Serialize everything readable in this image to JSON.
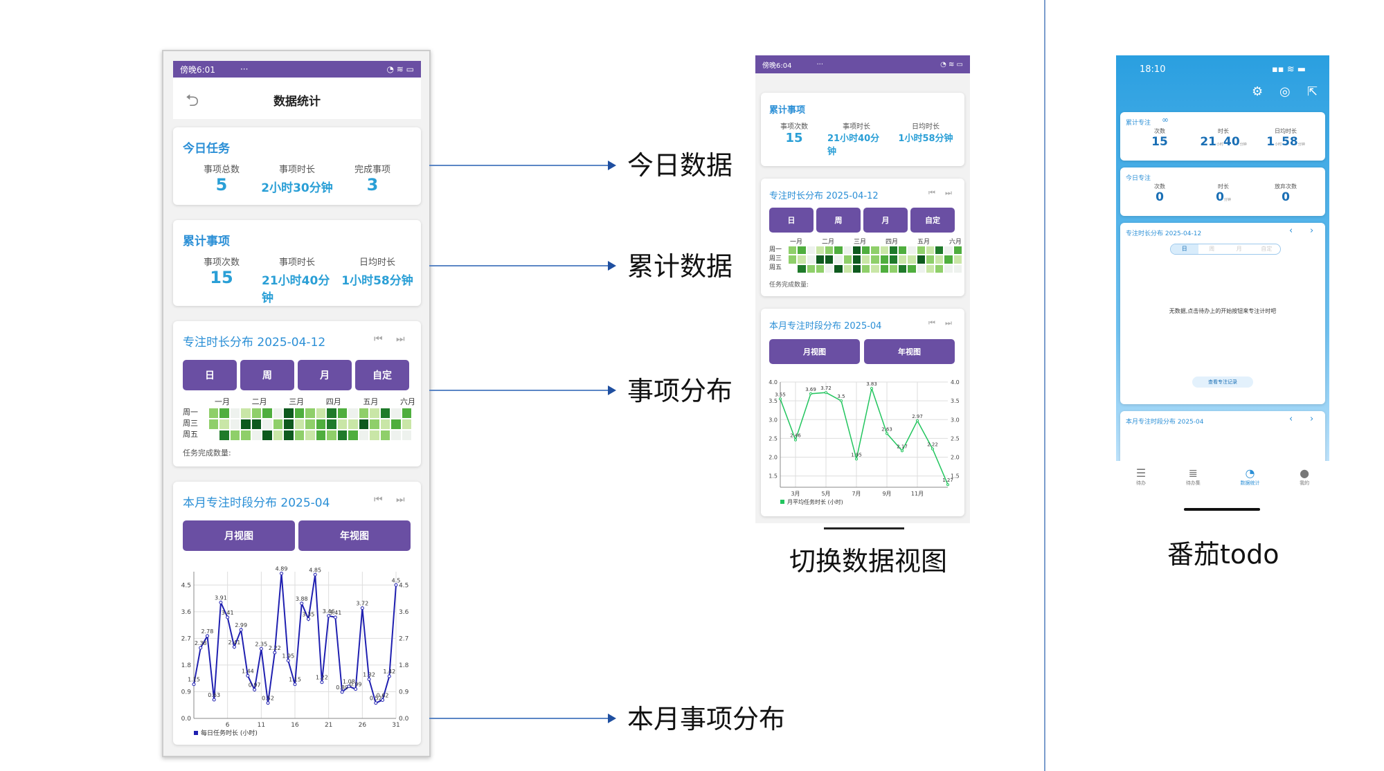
{
  "colors": {
    "purple": "#6a4fa3",
    "blue": "#2b8fd6",
    "green": "#22c55e",
    "navy": "#1f1fb0"
  },
  "phone1": {
    "status": {
      "time": "傍晚6:01",
      "battery": "73",
      "dots": "···"
    },
    "header": {
      "title": "数据统计"
    },
    "today": {
      "title": "今日任务",
      "items": [
        {
          "label": "事项总数",
          "value": "5"
        },
        {
          "label": "事项时长",
          "value": "2小时30分钟"
        },
        {
          "label": "完成事项",
          "value": "3"
        }
      ]
    },
    "total": {
      "title": "累计事项",
      "items": [
        {
          "label": "事项次数",
          "value": "15"
        },
        {
          "label": "事项时长",
          "value": "21小时40分钟"
        },
        {
          "label": "日均时长",
          "value": "1小时58分钟"
        }
      ]
    },
    "dist": {
      "title": "专注时长分布 2025-04-12",
      "tabs": [
        "日",
        "周",
        "月",
        "自定"
      ],
      "months": [
        "一月",
        "二月",
        "三月",
        "四月",
        "五月",
        "六月"
      ],
      "days": [
        "周一",
        "周三",
        "周五"
      ],
      "footer": "任务完成数量:"
    },
    "monthly": {
      "title": "本月专注时段分布 2025-04",
      "views": [
        "月视图",
        "年视图"
      ],
      "legend": "每日任务时长 (小时)"
    }
  },
  "phone2": {
    "status": {
      "time": "傍晚6:04",
      "dots": "···"
    },
    "total": {
      "title": "累计事项",
      "items": [
        {
          "label": "事项次数",
          "value": "15"
        },
        {
          "label": "事项时长",
          "value": "21小时40分钟"
        },
        {
          "label": "日均时长",
          "value": "1小时58分钟"
        }
      ]
    },
    "dist": {
      "title": "专注时长分布 2025-04-12",
      "tabs": [
        "日",
        "周",
        "月",
        "自定"
      ],
      "months": [
        "一月",
        "二月",
        "三月",
        "四月",
        "五月",
        "六月"
      ],
      "days": [
        "周一",
        "周三",
        "周五"
      ],
      "footer": "任务完成数量:"
    },
    "monthly": {
      "title": "本月专注时段分布 2025-04",
      "views": [
        "月视图",
        "年视图"
      ],
      "legend": "月平均任务时长 (小时)"
    }
  },
  "phone3": {
    "status": {
      "time": "18:10"
    },
    "focus_total": {
      "title": "累计专注",
      "items": [
        {
          "label": "次数",
          "value": "15",
          "unit": ""
        },
        {
          "label": "时长",
          "value": "21",
          "unit": "小时",
          "value2": "40",
          "unit2": "分钟"
        },
        {
          "label": "日均时长",
          "value": "1",
          "unit": "小时",
          "value2": "58",
          "unit2": "分钟"
        }
      ]
    },
    "focus_today": {
      "title": "今日专注",
      "items": [
        {
          "label": "次数",
          "value": "0",
          "unit": ""
        },
        {
          "label": "时长",
          "value": "0",
          "unit": "分钟"
        },
        {
          "label": "放弃次数",
          "value": "0",
          "unit": ""
        }
      ]
    },
    "dist": {
      "title": "专注时长分布 2025-04-12",
      "tabs": [
        "日",
        "周",
        "月",
        "自定"
      ],
      "empty": "无数据,点击待办上的开始按钮来专注计时吧",
      "record_btn": "查看专注记录"
    },
    "monthly": {
      "title": "本月专注时段分布 2025-04"
    },
    "tabbar": [
      {
        "label": "待办"
      },
      {
        "label": "待办集"
      },
      {
        "label": "数据统计"
      },
      {
        "label": "我的"
      }
    ]
  },
  "annotations": {
    "today": "今日数据",
    "total": "累计数据",
    "dist": "事项分布",
    "monthly": "本月事项分布",
    "switch": "切换数据视图",
    "app": "番茄todo"
  },
  "chart_data": [
    {
      "type": "line",
      "title": "本月专注时段分布 2025-04",
      "series": [
        {
          "name": "每日任务时长 (小时)",
          "x": [
            1,
            2,
            3,
            4,
            5,
            6,
            7,
            8,
            9,
            10,
            11,
            12,
            13,
            14,
            15,
            16,
            17,
            18,
            19,
            20,
            21,
            22,
            23,
            24,
            25,
            26,
            27,
            28,
            29,
            30,
            31
          ],
          "values": [
            1.15,
            2.38,
            2.78,
            0.63,
            3.91,
            3.41,
            2.41,
            2.99,
            1.44,
            0.97,
            2.35,
            0.52,
            2.22,
            4.89,
            1.95,
            1.15,
            3.88,
            3.35,
            4.85,
            1.22,
            3.46,
            3.41,
            0.89,
            1.08,
            0.99,
            3.72,
            1.32,
            0.52,
            0.62,
            1.42,
            4.5
          ]
        }
      ],
      "xticks": [
        6,
        11,
        16,
        21,
        26,
        31
      ],
      "ylim": [
        0,
        4.95
      ],
      "yticks": [
        0.0,
        0.9,
        1.8,
        2.7,
        3.6,
        4.5
      ]
    },
    {
      "type": "line",
      "title": "本月专注时段分布 2025-04",
      "series": [
        {
          "name": "月平均任务时长 (小时)",
          "x": [
            1,
            2,
            3,
            4,
            5,
            6,
            7,
            8,
            9,
            10,
            11,
            12
          ],
          "values": [
            3.55,
            2.46,
            3.69,
            3.72,
            3.5,
            1.95,
            3.83,
            2.63,
            2.17,
            2.97,
            2.22,
            1.27
          ]
        }
      ],
      "xticklabels": [
        "3月",
        "5月",
        "7月",
        "9月",
        "11月"
      ],
      "xticks": [
        2,
        4,
        6,
        8,
        10
      ],
      "ylim": [
        1.2,
        4.0
      ],
      "yticks": [
        1.5,
        2.0,
        2.5,
        3.0,
        3.5,
        4.0
      ]
    }
  ]
}
